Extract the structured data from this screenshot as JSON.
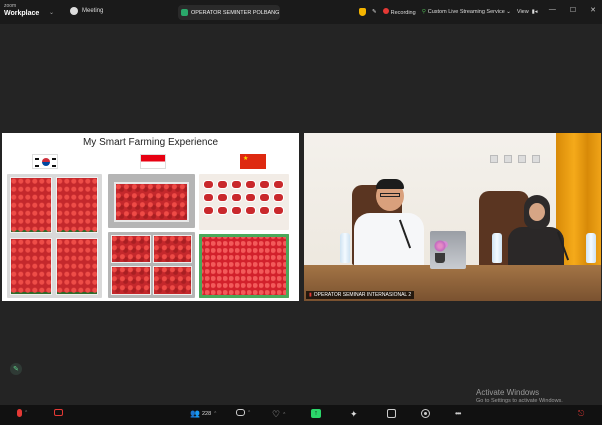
{
  "app": {
    "brand_line1": "zoom",
    "brand_line2": "Workplace",
    "meeting_tab": "Meeting",
    "center_tab": "OPERATOR SEMINTER POLBANG"
  },
  "status": {
    "recording": "Recording",
    "live": "Custom Live Streaming Service",
    "view": "View"
  },
  "window_controls": [
    "—",
    "☐",
    "✕"
  ],
  "share": {
    "slide_title": "My Smart Farming Experience"
  },
  "video": {
    "participant_name": "OPERATOR SEMINAR INTERNASIONAL 2"
  },
  "watermark": {
    "title": "Activate Windows",
    "subtitle": "Go to Settings to activate Windows."
  },
  "toolbar": {
    "participants_count": "228"
  },
  "colors": {
    "recording": "#e53935",
    "share_green": "#2bd66a",
    "tab_green": "#2aa86a",
    "curtain": "#f5aa1a"
  }
}
